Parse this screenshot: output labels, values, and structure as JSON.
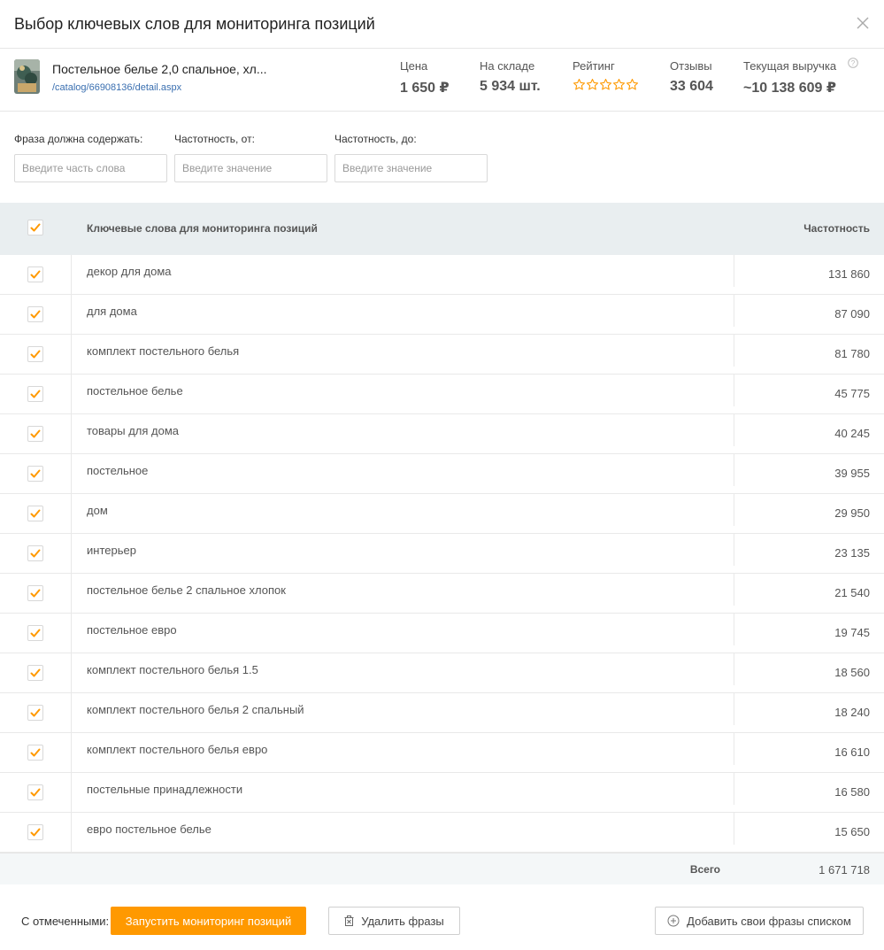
{
  "title": "Выбор ключевых слов для мониторинга позиций",
  "product": {
    "name": "Постельное белье 2,0 спальное, хл...",
    "link": "/catalog/66908136/detail.aspx",
    "metrics": {
      "price_label": "Цена",
      "price_value": "1 650 ₽",
      "stock_label": "На складе",
      "stock_value": "5 934 шт.",
      "rating_label": "Рейтинг",
      "rating_stars": 0,
      "reviews_label": "Отзывы",
      "reviews_value": "33 604",
      "revenue_label": "Текущая выручка",
      "revenue_value": "~10 138 609 ₽"
    }
  },
  "filters": {
    "phrase_label": "Фраза должна содержать:",
    "phrase_placeholder": "Введите часть слова",
    "freq_from_label": "Частотность, от:",
    "freq_from_placeholder": "Введите значение",
    "freq_to_label": "Частотность, до:",
    "freq_to_placeholder": "Введите значение"
  },
  "table": {
    "col_keyword": "Ключевые слова для мониторинга позиций",
    "col_frequency": "Частотность",
    "rows": [
      {
        "keyword": "декор для дома",
        "frequency": "131 860"
      },
      {
        "keyword": "для дома",
        "frequency": "87 090"
      },
      {
        "keyword": "комплект постельного белья",
        "frequency": "81 780"
      },
      {
        "keyword": "постельное белье",
        "frequency": "45 775"
      },
      {
        "keyword": "товары для дома",
        "frequency": "40 245"
      },
      {
        "keyword": "постельное",
        "frequency": "39 955"
      },
      {
        "keyword": "дом",
        "frequency": "29 950"
      },
      {
        "keyword": "интерьер",
        "frequency": "23 135"
      },
      {
        "keyword": "постельное белье 2 спальное хлопок",
        "frequency": "21 540"
      },
      {
        "keyword": "постельное евро",
        "frequency": "19 745"
      },
      {
        "keyword": "комплект постельного белья 1.5",
        "frequency": "18 560"
      },
      {
        "keyword": "комплект постельного белья 2 спальный",
        "frequency": "18 240"
      },
      {
        "keyword": "комплект постельного белья евро",
        "frequency": "16 610"
      },
      {
        "keyword": "постельные принадлежности",
        "frequency": "16 580"
      },
      {
        "keyword": "евро постельное белье",
        "frequency": "15 650"
      }
    ],
    "total_label": "Всего",
    "total_value": "1 671 718"
  },
  "footer": {
    "with_checked": "С отмеченными:",
    "start_monitoring": "Запустить мониторинг позиций",
    "delete_phrases": "Удалить фразы",
    "add_phrases": "Добавить свои фразы списком"
  },
  "colors": {
    "accent": "#ff9900",
    "header_bg": "#e9eef0",
    "link": "#3a6fb0"
  }
}
